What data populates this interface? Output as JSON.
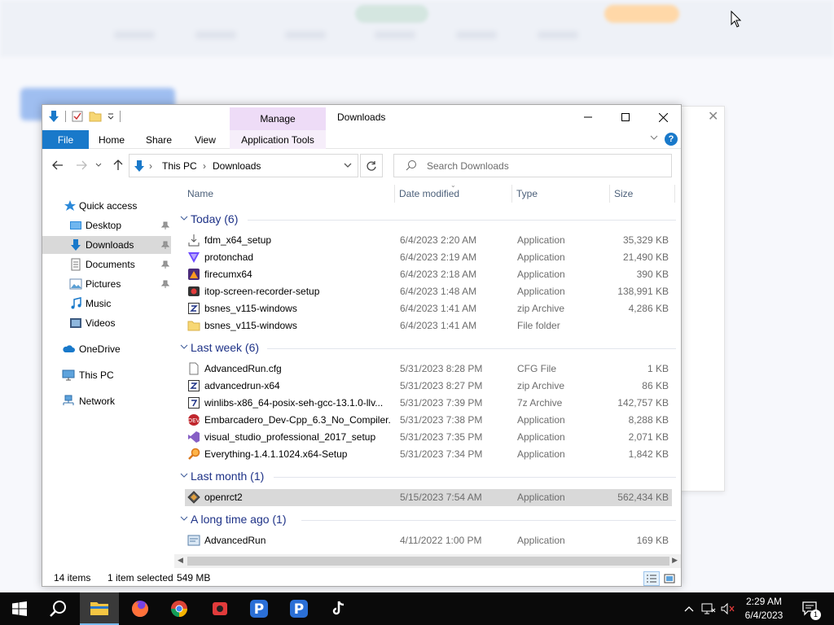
{
  "window": {
    "title": "Downloads",
    "manage_label": "Manage",
    "tabs": [
      "File",
      "Home",
      "Share",
      "View",
      "Application Tools"
    ],
    "help": "?"
  },
  "breadcrumb": [
    "This PC",
    "Downloads"
  ],
  "search": {
    "placeholder": "Search Downloads"
  },
  "nav_pane": [
    {
      "label": "Quick access",
      "icon": "star-icon"
    },
    {
      "label": "Desktop",
      "icon": "desktop-icon",
      "pinned": true
    },
    {
      "label": "Downloads",
      "icon": "download-icon",
      "pinned": true,
      "selected": true
    },
    {
      "label": "Documents",
      "icon": "documents-icon",
      "pinned": true
    },
    {
      "label": "Pictures",
      "icon": "pictures-icon",
      "pinned": true
    },
    {
      "label": "Music",
      "icon": "music-icon"
    },
    {
      "label": "Videos",
      "icon": "videos-icon"
    },
    {
      "label": "OneDrive",
      "icon": "cloud-icon"
    },
    {
      "label": "This PC",
      "icon": "computer-icon"
    },
    {
      "label": "Network",
      "icon": "network-icon"
    }
  ],
  "columns": {
    "name": "Name",
    "date": "Date modified",
    "type": "Type",
    "size": "Size"
  },
  "groups": [
    {
      "label": "Today (6)",
      "files": [
        {
          "name": "fdm_x64_setup",
          "date": "6/4/2023 2:20 AM",
          "type": "Application",
          "size": "35,329 KB",
          "icon": "installer-icon"
        },
        {
          "name": "protonchad",
          "date": "6/4/2023 2:19 AM",
          "type": "Application",
          "size": "21,490 KB",
          "icon": "proton-icon"
        },
        {
          "name": "firecumx64",
          "date": "6/4/2023 2:18 AM",
          "type": "Application",
          "size": "390 KB",
          "icon": "firecum-icon"
        },
        {
          "name": "itop-screen-recorder-setup",
          "date": "6/4/2023 1:48 AM",
          "type": "Application",
          "size": "138,991 KB",
          "icon": "recorder-icon"
        },
        {
          "name": "bsnes_v115-windows",
          "date": "6/4/2023 1:41 AM",
          "type": "zip Archive",
          "size": "4,286 KB",
          "icon": "archive-icon"
        },
        {
          "name": "bsnes_v115-windows",
          "date": "6/4/2023 1:41 AM",
          "type": "File folder",
          "size": "",
          "icon": "folder-icon"
        }
      ]
    },
    {
      "label": "Last week (6)",
      "files": [
        {
          "name": "AdvancedRun.cfg",
          "date": "5/31/2023 8:28 PM",
          "type": "CFG File",
          "size": "1 KB",
          "icon": "file-icon"
        },
        {
          "name": "advancedrun-x64",
          "date": "5/31/2023 8:27 PM",
          "type": "zip Archive",
          "size": "86 KB",
          "icon": "archive-icon"
        },
        {
          "name": "winlibs-x86_64-posix-seh-gcc-13.1.0-llv...",
          "date": "5/31/2023 7:39 PM",
          "type": "7z Archive",
          "size": "142,757 KB",
          "icon": "archive-icon"
        },
        {
          "name": "Embarcadero_Dev-Cpp_6.3_No_Compiler...",
          "date": "5/31/2023 7:38 PM",
          "type": "Application",
          "size": "8,288 KB",
          "icon": "devcpp-icon"
        },
        {
          "name": "visual_studio_professional_2017_setup",
          "date": "5/31/2023 7:35 PM",
          "type": "Application",
          "size": "2,071 KB",
          "icon": "visual-studio-icon"
        },
        {
          "name": "Everything-1.4.1.1024.x64-Setup",
          "date": "5/31/2023 7:34 PM",
          "type": "Application",
          "size": "1,842 KB",
          "icon": "magnifier-icon"
        }
      ]
    },
    {
      "label": "Last month (1)",
      "files": [
        {
          "name": "openrct2",
          "date": "5/15/2023 7:54 AM",
          "type": "Application",
          "size": "562,434 KB",
          "icon": "openrct2-icon",
          "selected": true
        }
      ]
    },
    {
      "label": "A long time ago (1)",
      "files": [
        {
          "name": "AdvancedRun",
          "date": "4/11/2022 1:00 PM",
          "type": "Application",
          "size": "169 KB",
          "icon": "advancedrun-icon"
        }
      ]
    }
  ],
  "status": {
    "items": "14 items",
    "selected": "1 item selected",
    "size": "549 MB"
  },
  "clock": {
    "time": "2:29 AM",
    "date": "6/4/2023"
  },
  "notification_count": "1",
  "colors": {
    "accent": "#1979ca",
    "manage": "#eedcf7",
    "group_text": "#1e3287",
    "selection": "#d9d9d9"
  }
}
